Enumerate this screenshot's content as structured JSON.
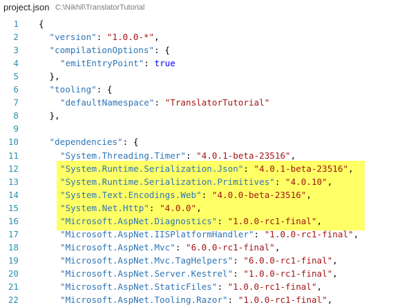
{
  "tab": {
    "file_name": "project.json",
    "path": "C:\\Nikhil\\TranslatorTutorial"
  },
  "colors": {
    "line_number": "#2b91af",
    "json_key": "#2e75b6",
    "json_string": "#a31515",
    "json_keyword": "#0000ff",
    "highlight": "#ffff66"
  },
  "lines": [
    {
      "n": "1",
      "indent": 0,
      "tokens": [
        [
          "pun",
          "{"
        ]
      ]
    },
    {
      "n": "2",
      "indent": 1,
      "tokens": [
        [
          "key",
          "\"version\""
        ],
        [
          "pun",
          ": "
        ],
        [
          "str",
          "\"1.0.0-*\""
        ],
        [
          "pun",
          ","
        ]
      ]
    },
    {
      "n": "3",
      "indent": 1,
      "tokens": [
        [
          "key",
          "\"compilationOptions\""
        ],
        [
          "pun",
          ": {"
        ]
      ]
    },
    {
      "n": "4",
      "indent": 2,
      "tokens": [
        [
          "key",
          "\"emitEntryPoint\""
        ],
        [
          "pun",
          ": "
        ],
        [
          "kw",
          "true"
        ]
      ]
    },
    {
      "n": "5",
      "indent": 1,
      "tokens": [
        [
          "pun",
          "},"
        ]
      ]
    },
    {
      "n": "6",
      "indent": 1,
      "tokens": [
        [
          "key",
          "\"tooling\""
        ],
        [
          "pun",
          ": {"
        ]
      ]
    },
    {
      "n": "7",
      "indent": 2,
      "tokens": [
        [
          "key",
          "\"defaultNamespace\""
        ],
        [
          "pun",
          ": "
        ],
        [
          "str",
          "\"TranslatorTutorial\""
        ]
      ]
    },
    {
      "n": "8",
      "indent": 1,
      "tokens": [
        [
          "pun",
          "},"
        ]
      ]
    },
    {
      "n": "9",
      "indent": 0,
      "tokens": []
    },
    {
      "n": "10",
      "indent": 1,
      "tokens": [
        [
          "key",
          "\"dependencies\""
        ],
        [
          "pun",
          ": {"
        ]
      ]
    },
    {
      "n": "11",
      "indent": 2,
      "tokens": [
        [
          "key",
          "\"System.Threading.Timer\""
        ],
        [
          "pun",
          ": "
        ],
        [
          "str",
          "\"4.0.1-beta-23516\""
        ],
        [
          "pun",
          ","
        ]
      ]
    },
    {
      "n": "12",
      "indent": 2,
      "tokens": [
        [
          "key",
          "\"System.Runtime.Serialization.Json\""
        ],
        [
          "pun",
          ": "
        ],
        [
          "str",
          "\"4.0.1-beta-23516\""
        ],
        [
          "pun",
          ","
        ]
      ]
    },
    {
      "n": "13",
      "indent": 2,
      "tokens": [
        [
          "key",
          "\"System.Runtime.Serialization.Primitives\""
        ],
        [
          "pun",
          ": "
        ],
        [
          "str",
          "\"4.0.10\""
        ],
        [
          "pun",
          ","
        ]
      ]
    },
    {
      "n": "14",
      "indent": 2,
      "tokens": [
        [
          "key",
          "\"System.Text.Encodings.Web\""
        ],
        [
          "pun",
          ": "
        ],
        [
          "str",
          "\"4.0.0-beta-23516\""
        ],
        [
          "pun",
          ","
        ]
      ]
    },
    {
      "n": "15",
      "indent": 2,
      "tokens": [
        [
          "key",
          "\"System.Net.Http\""
        ],
        [
          "pun",
          ": "
        ],
        [
          "str",
          "\"4.0.0\""
        ],
        [
          "pun",
          ","
        ]
      ]
    },
    {
      "n": "16",
      "indent": 2,
      "tokens": [
        [
          "key",
          "\"Microsoft.AspNet.Diagnostics\""
        ],
        [
          "pun",
          ": "
        ],
        [
          "str",
          "\"1.0.0-rc1-final\""
        ],
        [
          "pun",
          ","
        ]
      ]
    },
    {
      "n": "17",
      "indent": 2,
      "tokens": [
        [
          "key",
          "\"Microsoft.AspNet.IISPlatformHandler\""
        ],
        [
          "pun",
          ": "
        ],
        [
          "str",
          "\"1.0.0-rc1-final\""
        ],
        [
          "pun",
          ","
        ]
      ]
    },
    {
      "n": "18",
      "indent": 2,
      "tokens": [
        [
          "key",
          "\"Microsoft.AspNet.Mvc\""
        ],
        [
          "pun",
          ": "
        ],
        [
          "str",
          "\"6.0.0-rc1-final\""
        ],
        [
          "pun",
          ","
        ]
      ]
    },
    {
      "n": "19",
      "indent": 2,
      "tokens": [
        [
          "key",
          "\"Microsoft.AspNet.Mvc.TagHelpers\""
        ],
        [
          "pun",
          ": "
        ],
        [
          "str",
          "\"6.0.0-rc1-final\""
        ],
        [
          "pun",
          ","
        ]
      ]
    },
    {
      "n": "20",
      "indent": 2,
      "tokens": [
        [
          "key",
          "\"Microsoft.AspNet.Server.Kestrel\""
        ],
        [
          "pun",
          ": "
        ],
        [
          "str",
          "\"1.0.0-rc1-final\""
        ],
        [
          "pun",
          ","
        ]
      ]
    },
    {
      "n": "21",
      "indent": 2,
      "tokens": [
        [
          "key",
          "\"Microsoft.AspNet.StaticFiles\""
        ],
        [
          "pun",
          ": "
        ],
        [
          "str",
          "\"1.0.0-rc1-final\""
        ],
        [
          "pun",
          ","
        ]
      ]
    },
    {
      "n": "22",
      "indent": 2,
      "tokens": [
        [
          "key",
          "\"Microsoft.AspNet.Tooling.Razor\""
        ],
        [
          "pun",
          ": "
        ],
        [
          "str",
          "\"1.0.0-rc1-final\""
        ],
        [
          "pun",
          ","
        ]
      ]
    }
  ]
}
